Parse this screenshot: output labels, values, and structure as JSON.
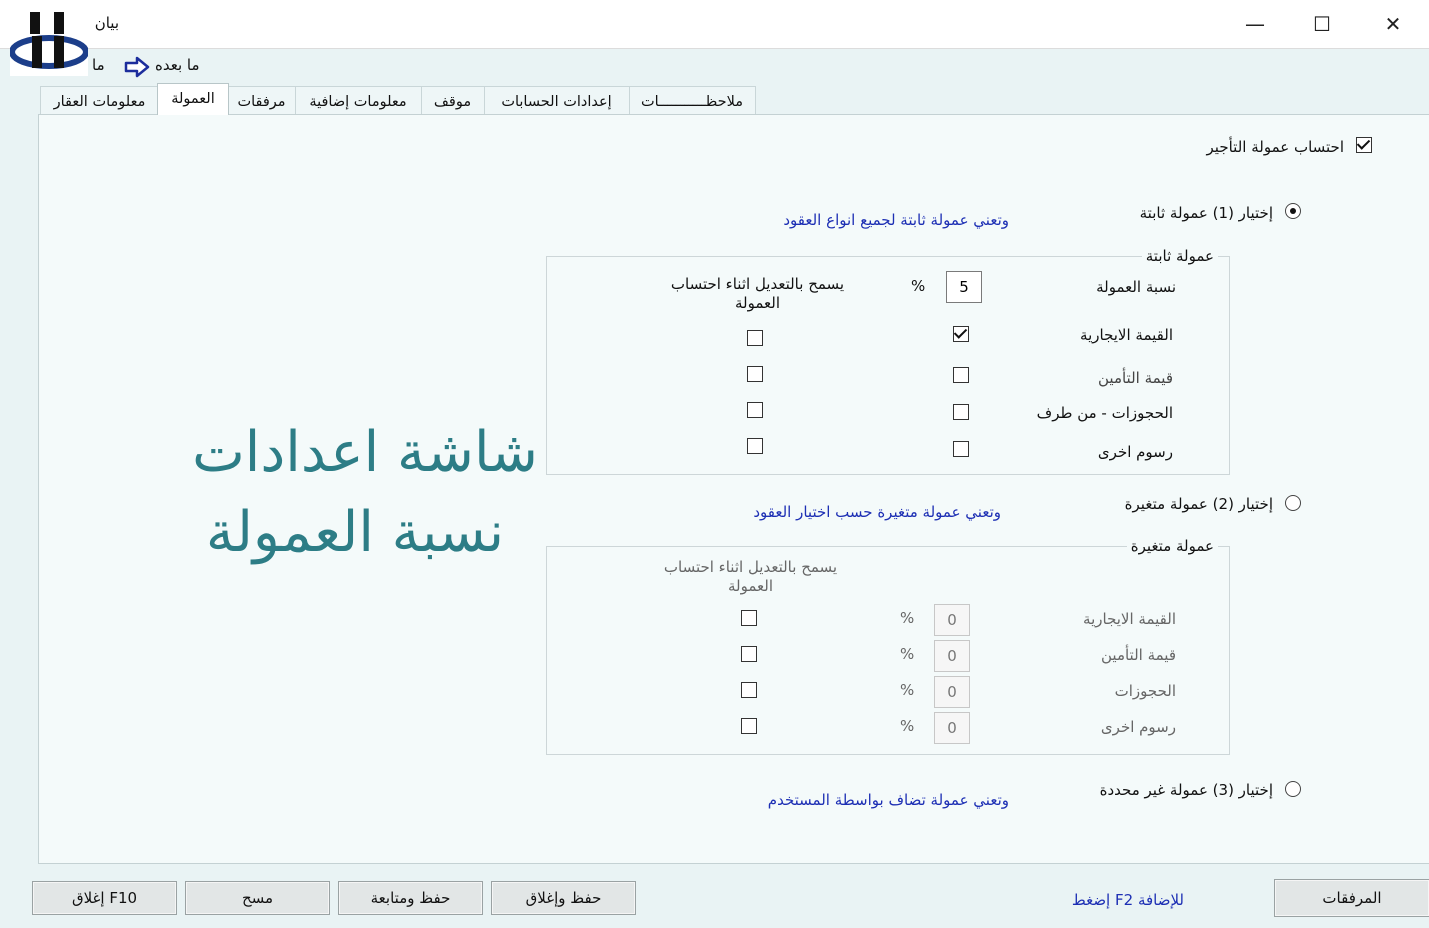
{
  "window": {
    "title": "بيان",
    "minimize": "—",
    "maximize": "☐",
    "close": "✕"
  },
  "toolbar": {
    "next_label": "ما بعده",
    "prev_label": "ما"
  },
  "tabs": [
    "ملاحظـــــــــــات",
    "إعدادات الحسابات",
    "موقف",
    "معلومات إضافية",
    "مرفقات",
    "العمولة",
    "معلومات العقار"
  ],
  "active_tab": "العمولة",
  "rent_commission_label": "احتساب عمولة التأجير",
  "option1": {
    "label": "إختيار (1) عمولة ثابتة",
    "desc": "وتعني عمولة ثابتة لجميع انواع العقود"
  },
  "fixed_group": {
    "legend": "عمولة ثابتة",
    "rate_label": "نسبة العمولة",
    "rate_value": "5",
    "percent": "%",
    "allow_header": "يسمح بالتعديل اثناء احتساب العمولة",
    "rows": [
      "القيمة الايجارية",
      "قيمة التأمين",
      "الحجوزات - من طرف",
      "رسوم اخرى"
    ]
  },
  "option2": {
    "label": "إختيار (2) عمولة متغيرة",
    "desc": "وتعني عمولة متغيرة حسب اختيار العقود"
  },
  "variable_group": {
    "legend": "عمولة متغيرة",
    "allow_header": "يسمح بالتعديل اثناء احتساب العمولة",
    "percent": "%",
    "rows": [
      {
        "label": "القيمة الايجارية",
        "value": "0"
      },
      {
        "label": "قيمة التأمين",
        "value": "0"
      },
      {
        "label": "الحجوزات",
        "value": "0"
      },
      {
        "label": "رسوم اخرى",
        "value": "0"
      }
    ]
  },
  "option3": {
    "label": "إختيار (3) عمولة غير محددة",
    "desc": "وتعني عمولة تضاف بواسطة المستخدم"
  },
  "overlay": {
    "line1": "شاشة اعدادات",
    "line2": "نسبة العمولة"
  },
  "footer": {
    "attachments": "المرفقات",
    "add_hint": "إضغط F2 للإضافة",
    "save_close": "حفظ وإغلاق",
    "save_continue": "حفظ ومتابعة",
    "clear": "مسح",
    "close_f10": "إغلاق F10"
  }
}
